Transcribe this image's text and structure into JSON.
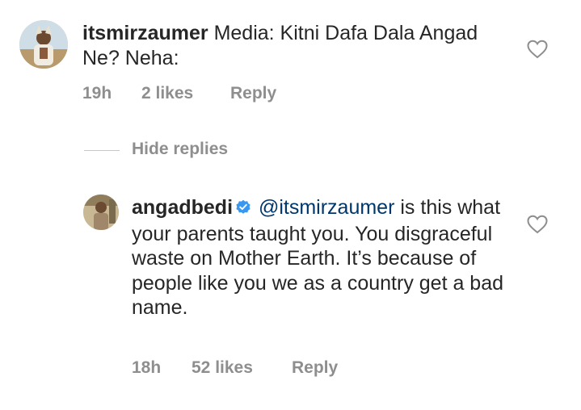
{
  "comments": [
    {
      "username": "itsmirzaumer",
      "text": "Media: Kitni Dafa Dala Angad Ne?  Neha:",
      "time": "19h",
      "likes": "2 likes",
      "reply_label": "Reply",
      "verified": false
    },
    {
      "username": "angadbedi",
      "mention": "@itsmirzaumer",
      "text": "is this what your parents taught you. You disgraceful waste on Mother Earth. It’s because of people like you we as a country get a bad name.",
      "time": "18h",
      "likes": "52 likes",
      "reply_label": "Reply",
      "verified": true
    }
  ],
  "replies_toggle": {
    "label": "Hide replies"
  },
  "icons": {
    "like": "heart-outline-icon",
    "verified": "verified-badge-icon"
  },
  "colors": {
    "text": "#262626",
    "muted": "#8e8e8e",
    "mention": "#00376b",
    "verified": "#3897f0"
  }
}
